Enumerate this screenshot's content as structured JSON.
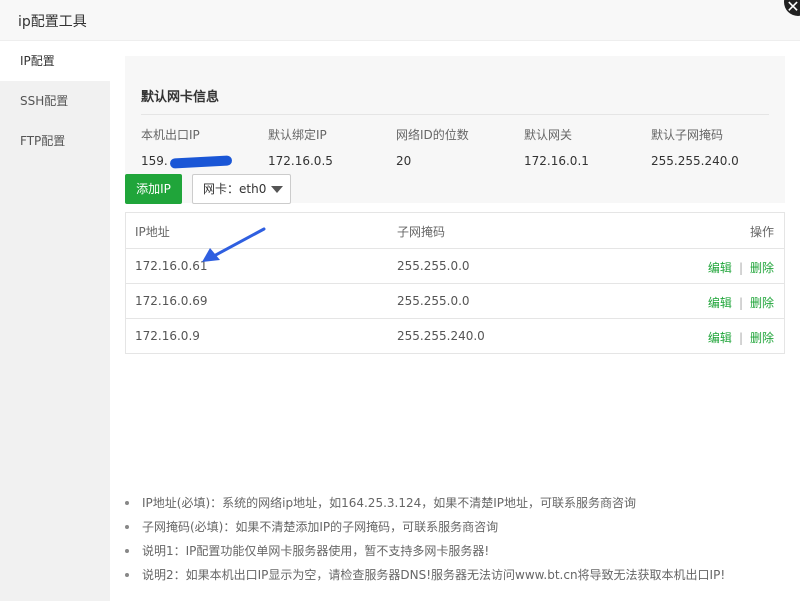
{
  "window": {
    "title": "ip配置工具",
    "close_icon": "close-icon"
  },
  "sidebar": {
    "items": [
      {
        "label": "IP配置",
        "active": true
      },
      {
        "label": "SSH配置",
        "active": false
      },
      {
        "label": "FTP配置",
        "active": false
      }
    ]
  },
  "info": {
    "title": "默认网卡信息",
    "fields": [
      {
        "label": "本机出口IP",
        "value": "159."
      },
      {
        "label": "默认绑定IP",
        "value": "172.16.0.5"
      },
      {
        "label": "网络ID的位数",
        "value": "20"
      },
      {
        "label": "默认网关",
        "value": "172.16.0.1"
      },
      {
        "label": "默认子网掩码",
        "value": "255.255.240.0"
      }
    ]
  },
  "toolbar": {
    "add_label": "添加IP",
    "nic_select_value": "网卡：eth0"
  },
  "table": {
    "headers": [
      "IP地址",
      "子网掩码",
      "操作"
    ],
    "rows": [
      {
        "ip": "172.16.0.61",
        "mask": "255.255.0.0"
      },
      {
        "ip": "172.16.0.69",
        "mask": "255.255.0.0"
      },
      {
        "ip": "172.16.0.9",
        "mask": "255.255.240.0"
      }
    ],
    "edit_label": "编辑",
    "separator": "|",
    "delete_label": "删除"
  },
  "notes": [
    "IP地址(必填)：系统的网络ip地址，如164.25.3.124，如果不清楚IP地址，可联系服务商咨询",
    "子网掩码(必填)：如果不清楚添加IP的子网掩码，可联系服务商咨询",
    "说明1：IP配置功能仅单网卡服务器使用，暂不支持多网卡服务器!",
    "说明2：如果本机出口IP显示为空，请检查服务器DNS!服务器无法访问www.bt.cn将导致无法获取本机出口IP!"
  ],
  "colors": {
    "accent": "#20a53a",
    "annotation_arrow": "#2f5fe0"
  }
}
